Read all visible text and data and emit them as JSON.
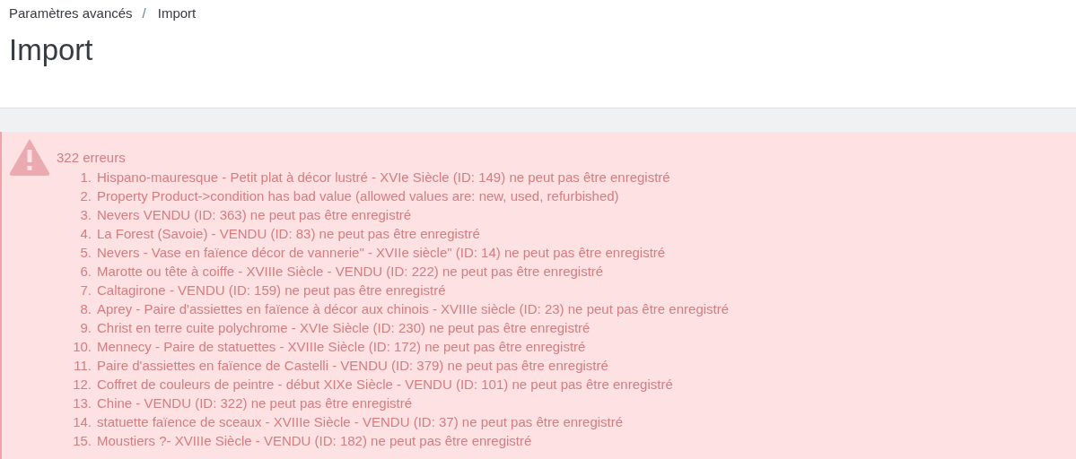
{
  "breadcrumb": [
    {
      "label": "Paramètres avancés"
    },
    {
      "label": "Import"
    }
  ],
  "breadcrumb_separator": "/",
  "title": "Import",
  "alert": {
    "kind": "error",
    "summary": "322 erreurs",
    "items": [
      {
        "number": "1.",
        "text": "Hispano-mauresque - Petit plat à décor lustré - XVIe Siècle (ID: 149) ne peut pas être enregistré"
      },
      {
        "number": "2.",
        "text": "Property Product->condition has bad value (allowed values are: new, used, refurbished)"
      },
      {
        "number": "3.",
        "text": "Nevers  VENDU (ID: 363) ne peut pas être enregistré"
      },
      {
        "number": "4.",
        "text": "La Forest (Savoie) - VENDU (ID: 83) ne peut pas être enregistré"
      },
      {
        "number": "5.",
        "text": "Nevers - Vase en faïence décor de vannerie\" - XVIIe siècle\" (ID: 14) ne peut pas être enregistré"
      },
      {
        "number": "6.",
        "text": "Marotte ou tête à coiffe - XVIIIe Siècle - VENDU (ID: 222) ne peut pas être enregistré"
      },
      {
        "number": "7.",
        "text": "Caltagirone - VENDU (ID: 159) ne peut pas être enregistré"
      },
      {
        "number": "8.",
        "text": "Aprey - Paire d'assiettes en faïence à décor aux chinois - XVIIIe siècle (ID: 23) ne peut pas être enregistré"
      },
      {
        "number": "9.",
        "text": "Christ en terre cuite polychrome - XVIe Siècle (ID: 230) ne peut pas être enregistré"
      },
      {
        "number": "10.",
        "text": "Mennecy - Paire de statuettes - XVIIIe Siècle (ID: 172) ne peut pas être enregistré"
      },
      {
        "number": "11.",
        "text": "Paire d'assiettes en faïence de Castelli - VENDU (ID: 379) ne peut pas être enregistré"
      },
      {
        "number": "12.",
        "text": "Coffret de couleurs de peintre - début XIXe Siècle - VENDU (ID: 101) ne peut pas être enregistré"
      },
      {
        "number": "13.",
        "text": "Chine - VENDU (ID: 322) ne peut pas être enregistré"
      },
      {
        "number": "14.",
        "text": "statuette faïence de sceaux - XVIIIe Siècle - VENDU (ID: 37) ne peut pas être enregistré"
      },
      {
        "number": "15.",
        "text": "Moustiers ?- XVIIIe Siècle - VENDU (ID: 182) ne peut pas être enregistré"
      }
    ]
  }
}
